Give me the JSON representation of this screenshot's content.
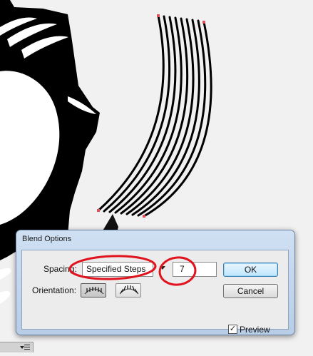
{
  "dialog": {
    "title": "Blend Options",
    "spacing_label": "Spacing:",
    "spacing_value": "Specified Steps",
    "steps_value": "7",
    "orientation_label": "Orientation:",
    "ok_label": "OK",
    "cancel_label": "Cancel",
    "preview_label": "Preview",
    "preview_checked": true,
    "check_glyph": "✓"
  },
  "icons": {
    "align-to-page": "align-to-page-icon",
    "align-to-path": "align-to-path-icon",
    "dropdown": "chevron-down-icon"
  },
  "colors": {
    "annotation_red": "#e0141e",
    "anchor_red": "#e0505a",
    "artwork_black": "#000000",
    "canvas": "#f2f1f1"
  }
}
